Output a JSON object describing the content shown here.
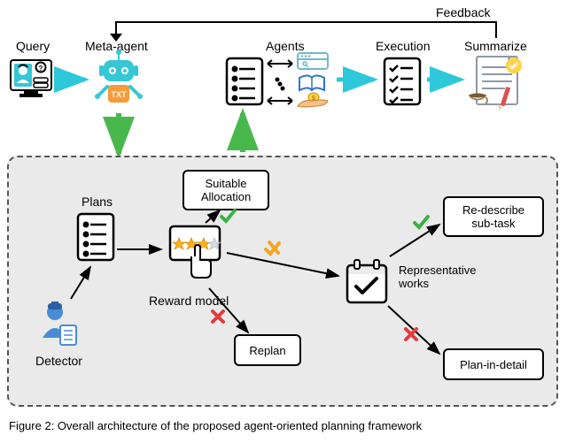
{
  "top_labels": {
    "query": "Query",
    "meta_agent": "Meta-agent",
    "agents": "Agents",
    "execution": "Execution",
    "summarize": "Summarize",
    "feedback": "Feedback"
  },
  "bottom_labels": {
    "plans": "Plans",
    "detector": "Detector",
    "reward_model": "Reward model",
    "suitable_allocation": "Suitable\nAllocation",
    "replan": "Replan",
    "representative_works": "Representative\nworks",
    "redescribe": "Re-describe\nsub-task",
    "plan_in_detail": "Plan-in-detail"
  },
  "caption_prefix": "Figure 2: Overall architecture of the proposed agent-oriented planning framework"
}
